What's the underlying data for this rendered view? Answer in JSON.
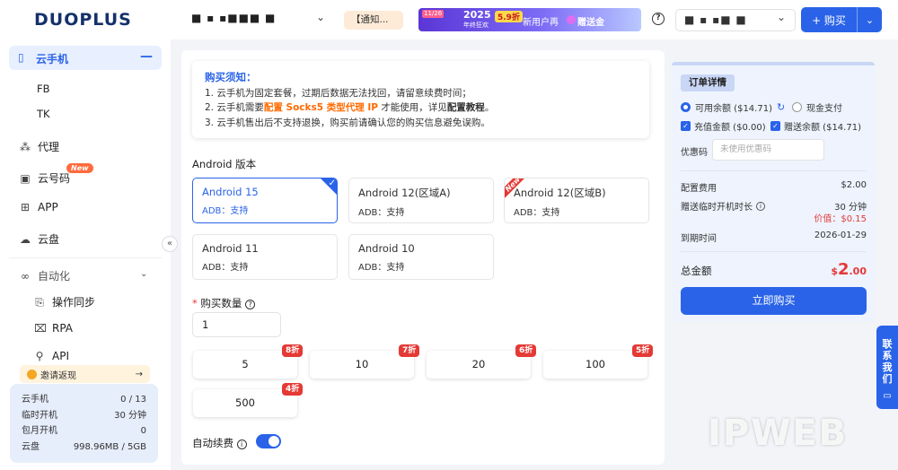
{
  "brand": {
    "logo": "DUOPLUS"
  },
  "topbar": {
    "account": "■ ▪ ▪■■■ ■",
    "notice": "【通知...",
    "banner": {
      "date": "11/26",
      "year": "2025",
      "sub": "年终狂欢",
      "promo": "5.9折",
      "text": "新用户再",
      "gift": "赠送金"
    },
    "help_icon": "?",
    "user": "■ ▪ ▪■ ■",
    "buy_label": "+ 购买"
  },
  "sidebar": {
    "cloud_phone": "云手机",
    "sub_fb": "FB",
    "sub_tk": "TK",
    "proxy": "代理",
    "cloud_number": "云号码",
    "new_badge": "New",
    "app": "APP",
    "cloud_disk": "云盘",
    "automation": "自动化",
    "op_sync": "操作同步",
    "rpa": "RPA",
    "api": "API",
    "invite": "邀请返现",
    "invite_arrow": "→",
    "quota": [
      {
        "label": "云手机",
        "value": "0 / 13"
      },
      {
        "label": "临时开机",
        "value": "30 分钟"
      },
      {
        "label": "包月开机",
        "value": "0"
      },
      {
        "label": "云盘",
        "value": "998.96MB / 5GB"
      }
    ]
  },
  "notice": {
    "title": "购买须知：",
    "line1": "1. 云手机为固定套餐，过期后数据无法找回，请留意续费时间；",
    "line2_a": "2. 云手机需要",
    "line2_b": "配置 Socks5 类型代理 IP",
    "line2_c": " 才能使用，详见",
    "line2_d": "配置教程",
    "line2_e": "。",
    "line3": "3. 云手机售出后不支持退换，购买前请确认您的购买信息避免误购。"
  },
  "android": {
    "label": "Android 版本",
    "versions": [
      {
        "name": "Android 15",
        "adb": "ADB：支持"
      },
      {
        "name": "Android 12(区域A)",
        "adb": "ADB：支持"
      },
      {
        "name": "Android 12(区域B)",
        "adb": "ADB：支持",
        "tag": "New"
      },
      {
        "name": "Android 11",
        "adb": "ADB：支持"
      },
      {
        "name": "Android 10",
        "adb": "ADB：支持"
      }
    ]
  },
  "quantity": {
    "required_mark": "*",
    "label": "购买数量",
    "value": "1",
    "options": [
      {
        "qty": "5",
        "disc": "8折"
      },
      {
        "qty": "10",
        "disc": "7折"
      },
      {
        "qty": "20",
        "disc": "6折"
      },
      {
        "qty": "100",
        "disc": "5折"
      },
      {
        "qty": "500",
        "disc": "4折"
      }
    ]
  },
  "auto_renew": {
    "label": "自动续费",
    "enabled": true
  },
  "order": {
    "title": "订单详情",
    "avail_balance": "可用余额 ($14.71)",
    "cash_pay": "现金支付",
    "recharge": "充值金额 ($0.00)",
    "gift_balance": "赠送余额 ($14.71)",
    "coupon_label": "优惠码",
    "coupon_placeholder": "未使用优惠码",
    "config_fee_label": "配置费用",
    "config_fee": "$2.00",
    "temp_label": "赠送临时开机时长",
    "temp_value": "30 分钟",
    "price_label": "价值：$0.15",
    "expire_label": "到期时间",
    "expire_value": "2026-01-29",
    "total_label": "总金额",
    "total_currency": "$",
    "total_int": "2",
    "total_dec": ".00",
    "buy_now": "立即购买"
  },
  "contact": {
    "label": "联系我们"
  },
  "watermark": "IPWEB",
  "colors": {
    "accent": "#2a63e8",
    "discount": "#e53935",
    "highlight": "#ff6a00"
  }
}
